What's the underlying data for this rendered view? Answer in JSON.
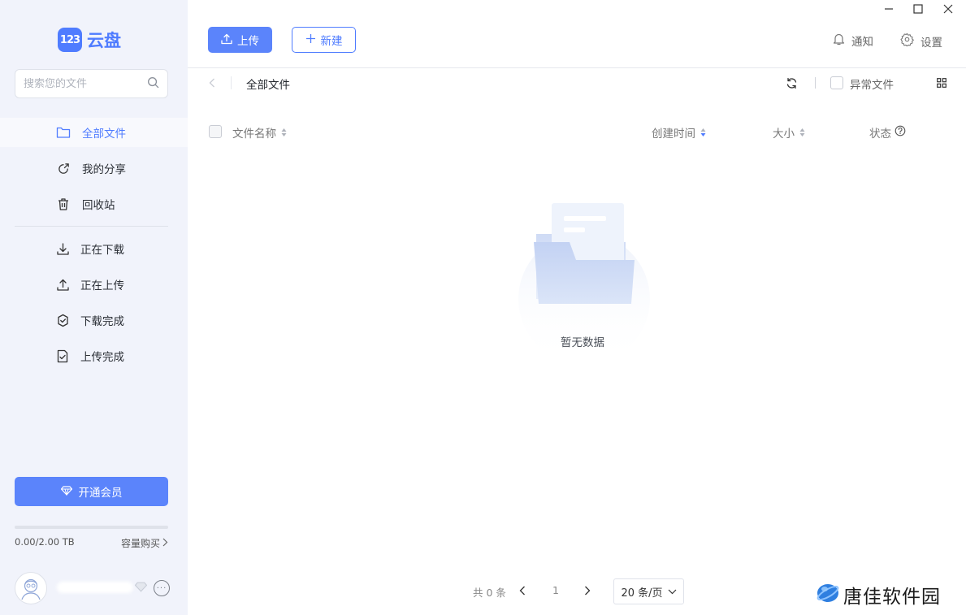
{
  "app": {
    "logo_badge": "123",
    "logo_text": "云盘"
  },
  "search": {
    "placeholder": "搜索您的文件"
  },
  "sidebar": {
    "items": [
      {
        "label": "全部文件",
        "icon": "folder-icon",
        "active": true
      },
      {
        "label": "我的分享",
        "icon": "share-icon"
      },
      {
        "label": "回收站",
        "icon": "trash-icon"
      }
    ],
    "transfer_items": [
      {
        "label": "正在下载",
        "icon": "download-icon"
      },
      {
        "label": "正在上传",
        "icon": "upload-icon"
      },
      {
        "label": "下载完成",
        "icon": "download-done-icon"
      },
      {
        "label": "上传完成",
        "icon": "upload-done-icon"
      }
    ],
    "vip_button": "开通会员",
    "capacity": {
      "text": "0.00/2.00 TB",
      "fraction": 0.0,
      "buy_label": "容量购买"
    }
  },
  "toolbar": {
    "upload_label": "上传",
    "new_label": "新建",
    "notify_label": "通知",
    "settings_label": "设置"
  },
  "breadcrumb": {
    "current": "全部文件"
  },
  "filters": {
    "abnormal_label": "异常文件"
  },
  "table": {
    "columns": {
      "name": "文件名称",
      "created": "创建时间",
      "size": "大小",
      "status": "状态"
    },
    "empty_text": "暂无数据"
  },
  "pagination": {
    "total": "共 0 条",
    "page": "1",
    "page_size": "20 条/页"
  },
  "watermark": {
    "text": "唐佳软件园"
  },
  "colors": {
    "accent": "#4f7cff",
    "button": "#5b84fb",
    "sidebar_bg": "#f1f3fb"
  }
}
